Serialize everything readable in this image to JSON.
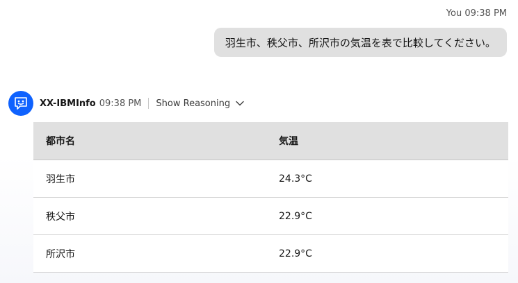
{
  "user_message": {
    "sender": "You",
    "time": "09:38 PM",
    "text": "羽生市、秩父市、所沢市の気温を表で比較してください。"
  },
  "bot_message": {
    "sender": "XX-IBMInfo",
    "time": "09:38 PM",
    "reasoning_label": "Show Reasoning",
    "avatar_icon": "chat-bot-icon",
    "accent_color": "#0f62fe"
  },
  "table": {
    "headers": [
      "都市名",
      "気温"
    ],
    "rows": [
      [
        "羽生市",
        "24.3°C"
      ],
      [
        "秩父市",
        "22.9°C"
      ],
      [
        "所沢市",
        "22.9°C"
      ]
    ]
  }
}
